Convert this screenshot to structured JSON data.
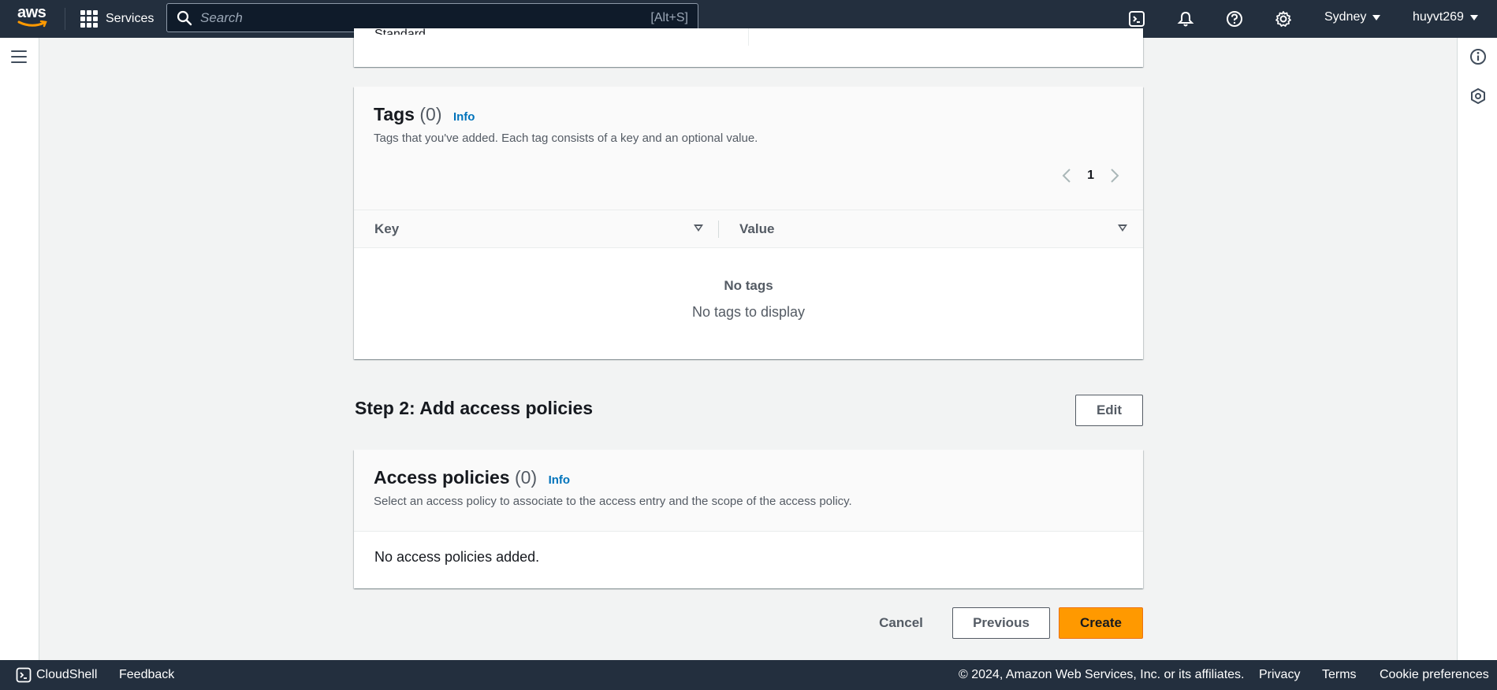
{
  "topnav": {
    "logo_text": "aws",
    "services_label": "Services",
    "search_placeholder": "Search",
    "search_shortcut": "[Alt+S]",
    "region": "Sydney",
    "account": "huyvt269",
    "icons": [
      "cloudshell-icon",
      "bell-icon",
      "help-icon",
      "gear-icon"
    ]
  },
  "top_panel": {
    "partial_text": "Standard"
  },
  "tags_panel": {
    "title": "Tags",
    "count": "(0)",
    "info": "Info",
    "description": "Tags that you've added. Each tag consists of a key and an optional value.",
    "page_number": "1",
    "columns": [
      "Key",
      "Value"
    ],
    "empty_title": "No tags",
    "empty_subtitle": "No tags to display"
  },
  "step2": {
    "heading": "Step 2: Add access policies",
    "edit_label": "Edit"
  },
  "access_panel": {
    "title": "Access policies",
    "count": "(0)",
    "info": "Info",
    "description": "Select an access policy to associate to the access entry and the scope of the access policy.",
    "empty_text": "No access policies added."
  },
  "actions": {
    "cancel": "Cancel",
    "previous": "Previous",
    "create": "Create"
  },
  "footer": {
    "cloudshell": "CloudShell",
    "feedback": "Feedback",
    "copyright": "© 2024, Amazon Web Services, Inc. or its affiliates.",
    "privacy": "Privacy",
    "terms": "Terms",
    "cookies": "Cookie preferences"
  },
  "colors": {
    "nav_bg": "#232f3e",
    "page_bg": "#f2f3f3",
    "primary_button": "#ff9900",
    "link": "#0073bb"
  }
}
